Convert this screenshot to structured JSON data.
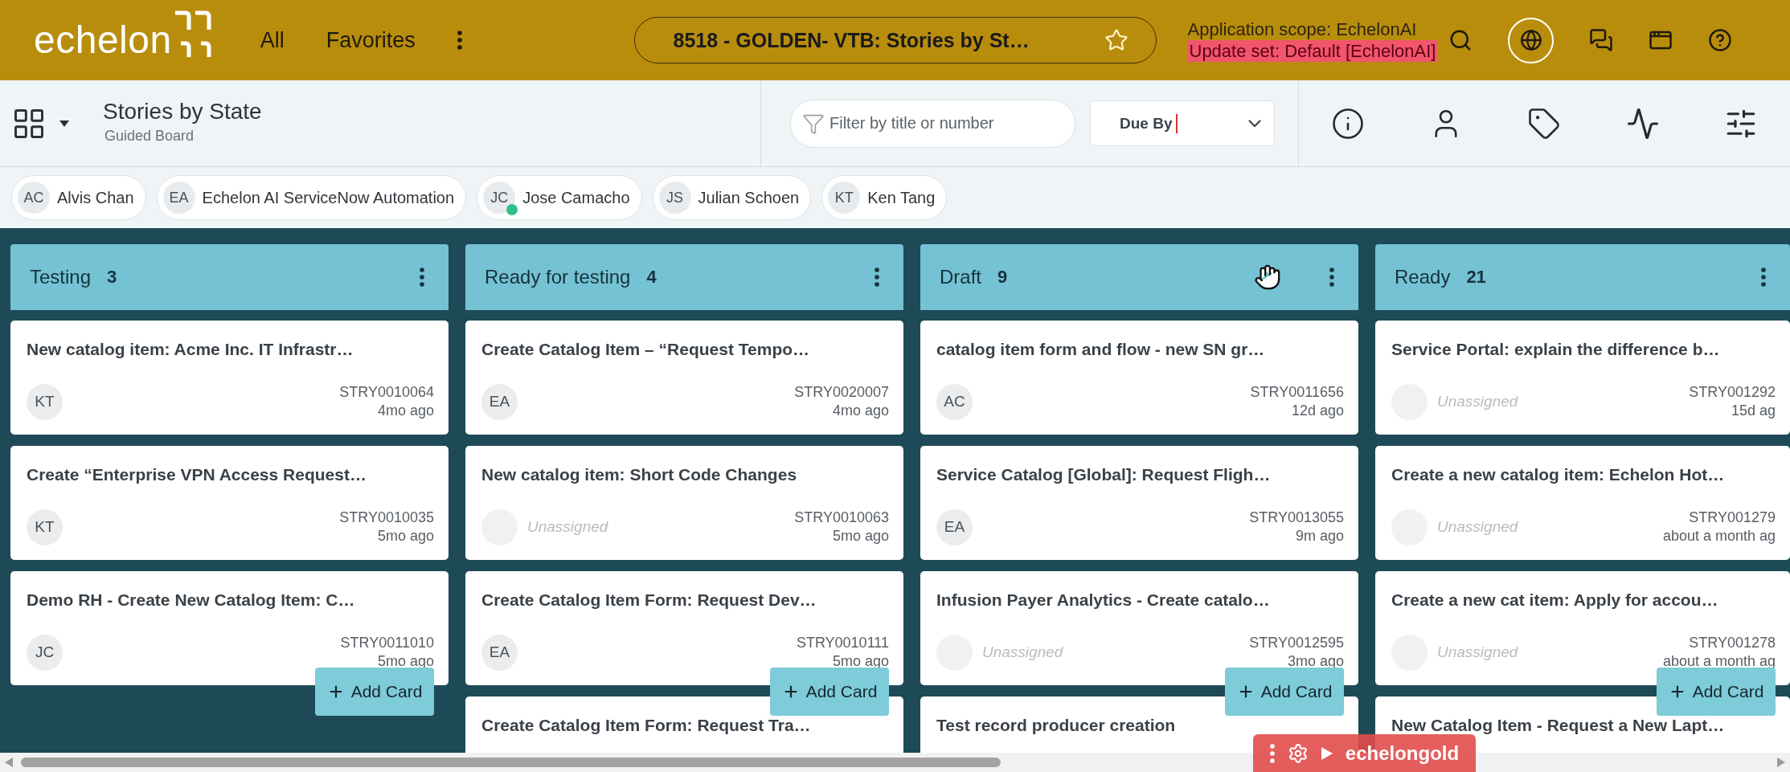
{
  "header": {
    "logo": "echelon",
    "nav": [
      {
        "label": "All"
      },
      {
        "label": "Favorites"
      }
    ],
    "record": {
      "title": "8518 - GOLDEN- VTB: Stories by St…",
      "favorite": false
    },
    "scope": {
      "application": "Application scope: EchelonAI",
      "update_set": "Update set: Default [EchelonAI]"
    }
  },
  "toolbar": {
    "title": "Stories by State",
    "subtitle": "Guided Board",
    "filter": {
      "placeholder": "Filter by title or number"
    },
    "due_by": {
      "label": "Due By",
      "focused": true
    }
  },
  "members": [
    {
      "initials": "AC",
      "name": "Alvis Chan",
      "online": false
    },
    {
      "initials": "EA",
      "name": "Echelon AI ServiceNow Automation",
      "online": false
    },
    {
      "initials": "JC",
      "name": "Jose Camacho",
      "online": true
    },
    {
      "initials": "JS",
      "name": "Julian Schoen",
      "online": false
    },
    {
      "initials": "KT",
      "name": "Ken Tang",
      "online": false
    }
  ],
  "columns": [
    {
      "name": "Testing",
      "count": "3",
      "hovered": false,
      "add_button": "Add Card",
      "cards": [
        {
          "title": "New catalog item: Acme Inc. IT Infrastr…",
          "assignee": {
            "kind": "person",
            "initials": "KT"
          },
          "number": "STRY0010064",
          "age": "4mo ago"
        },
        {
          "title": "Create “Enterprise VPN Access Request…",
          "assignee": {
            "kind": "person",
            "initials": "KT"
          },
          "number": "STRY0010035",
          "age": "5mo ago"
        },
        {
          "title": "Demo RH - Create New Catalog Item: C…",
          "assignee": {
            "kind": "person",
            "initials": "JC"
          },
          "number": "STRY0011010",
          "age": "5mo ago"
        }
      ]
    },
    {
      "name": "Ready for testing",
      "count": "4",
      "hovered": false,
      "add_button": "Add Card",
      "cards": [
        {
          "title": "Create Catalog Item – “Request Tempo…",
          "assignee": {
            "kind": "person",
            "initials": "EA"
          },
          "number": "STRY0020007",
          "age": "4mo ago"
        },
        {
          "title": "New catalog item: Short Code Changes",
          "assignee": {
            "kind": "unassigned",
            "label": "Unassigned"
          },
          "number": "STRY0010063",
          "age": "5mo ago"
        },
        {
          "title": "Create Catalog Item Form: Request Dev…",
          "assignee": {
            "kind": "person",
            "initials": "EA"
          },
          "number": "STRY0010111",
          "age": "5mo ago"
        },
        {
          "title": "Create Catalog Item Form: Request Tra…"
        }
      ]
    },
    {
      "name": "Draft",
      "count": "9",
      "hovered": true,
      "add_button": "Add Card",
      "cards": [
        {
          "title": "catalog item form and flow - new SN gr…",
          "assignee": {
            "kind": "person",
            "initials": "AC"
          },
          "number": "STRY0011656",
          "age": "12d ago"
        },
        {
          "title": "Service Catalog [Global]: Request Fligh…",
          "assignee": {
            "kind": "person",
            "initials": "EA"
          },
          "number": "STRY0013055",
          "age": "9m ago"
        },
        {
          "title": "Infusion Payer Analytics - Create catalo…",
          "assignee": {
            "kind": "unassigned",
            "label": "Unassigned"
          },
          "number": "STRY0012595",
          "age": "3mo ago"
        },
        {
          "title": "Test record producer creation"
        }
      ]
    },
    {
      "name": "Ready",
      "count": "21",
      "hovered": false,
      "add_button": "Add Card",
      "cards": [
        {
          "title": "Service Portal: explain the difference b…",
          "assignee": {
            "kind": "unassigned",
            "label": "Unassigned"
          },
          "number": "STRY001292",
          "age": "15d ag"
        },
        {
          "title": "Create a new catalog item: Echelon Hot…",
          "assignee": {
            "kind": "unassigned",
            "label": "Unassigned"
          },
          "number": "STRY001279",
          "age": "about a month ag"
        },
        {
          "title": "Create a new cat item: Apply for accou…",
          "assignee": {
            "kind": "unassigned",
            "label": "Unassigned"
          },
          "number": "STRY001278",
          "age": "about a month ag"
        },
        {
          "title": "New Catalog Item - Request a New Lapt…"
        }
      ]
    }
  ],
  "instance_badge": {
    "label": "echelongold"
  }
}
